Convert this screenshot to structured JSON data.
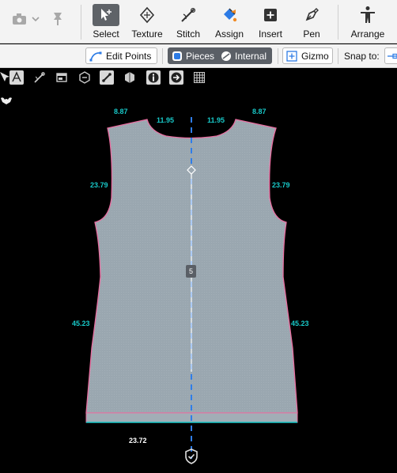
{
  "toolbar": {
    "select": "Select",
    "texture": "Texture",
    "stitch": "Stitch",
    "assign": "Assign",
    "insert": "Insert",
    "pen": "Pen",
    "arrange": "Arrange"
  },
  "subbar": {
    "edit_points": "Edit Points",
    "pieces": "Pieces",
    "internal": "Internal",
    "gizmo": "Gizmo",
    "snap_to": "Snap to:"
  },
  "pattern": {
    "neck_left_outer": "8.87",
    "neck_left_inner": "11.95",
    "neck_right_inner": "11.95",
    "neck_right_outer": "8.87",
    "armhole_left": "23.79",
    "armhole_right": "23.79",
    "side_left": "45.23",
    "side_right": "45.23",
    "hem": "23.72",
    "center_badge": "5"
  },
  "colors": {
    "fabric": "#9aa7b0",
    "outline": "#e96ea0",
    "measure": "#18c8c8",
    "axis": "#2f7de8",
    "active_tool": "#5f6368"
  }
}
